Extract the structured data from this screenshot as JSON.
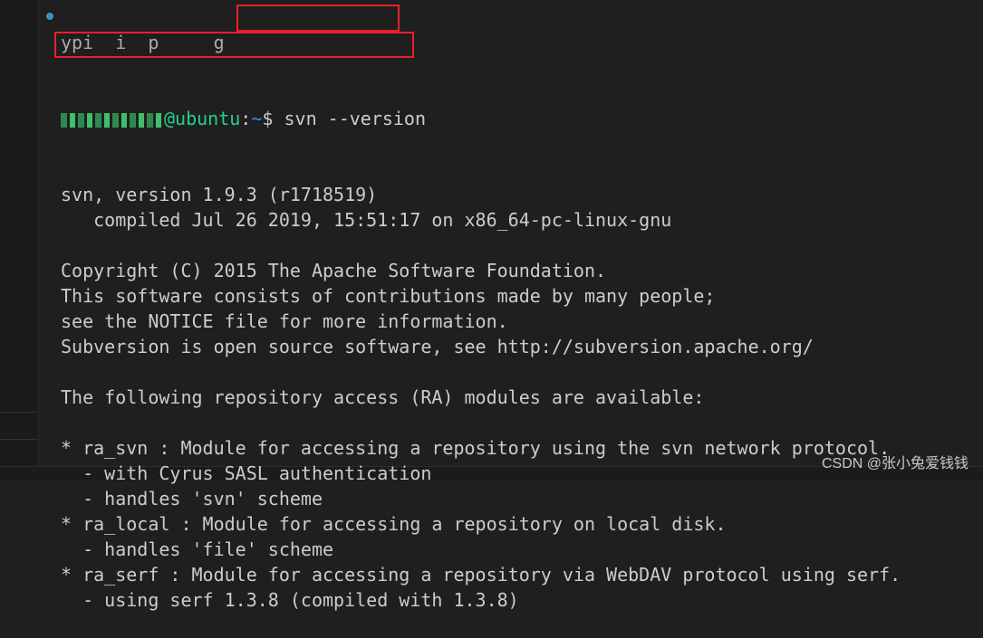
{
  "terminal": {
    "prompt": {
      "user_blurred": true,
      "host": "@ubuntu",
      "sep": ":",
      "path": "~",
      "symbol": "$ ",
      "command": "svn --version"
    },
    "top_partial": "ypi  i  p     g",
    "lines": [
      "svn, version 1.9.3 (r1718519)",
      "   compiled Jul 26 2019, 15:51:17 on x86_64-pc-linux-gnu",
      "",
      "Copyright (C) 2015 The Apache Software Foundation.",
      "This software consists of contributions made by many people;",
      "see the NOTICE file for more information.",
      "Subversion is open source software, see http://subversion.apache.org/",
      "",
      "The following repository access (RA) modules are available:",
      "",
      "* ra_svn : Module for accessing a repository using the svn network protocol.",
      "  - with Cyrus SASL authentication",
      "  - handles 'svn' scheme",
      "* ra_local : Module for accessing a repository on local disk.",
      "  - handles 'file' scheme",
      "* ra_serf : Module for accessing a repository via WebDAV protocol using serf.",
      "  - using serf 1.3.8 (compiled with 1.3.8)"
    ]
  },
  "highlight_color": "#e8202a",
  "watermark": "CSDN @张小兔爱钱钱"
}
